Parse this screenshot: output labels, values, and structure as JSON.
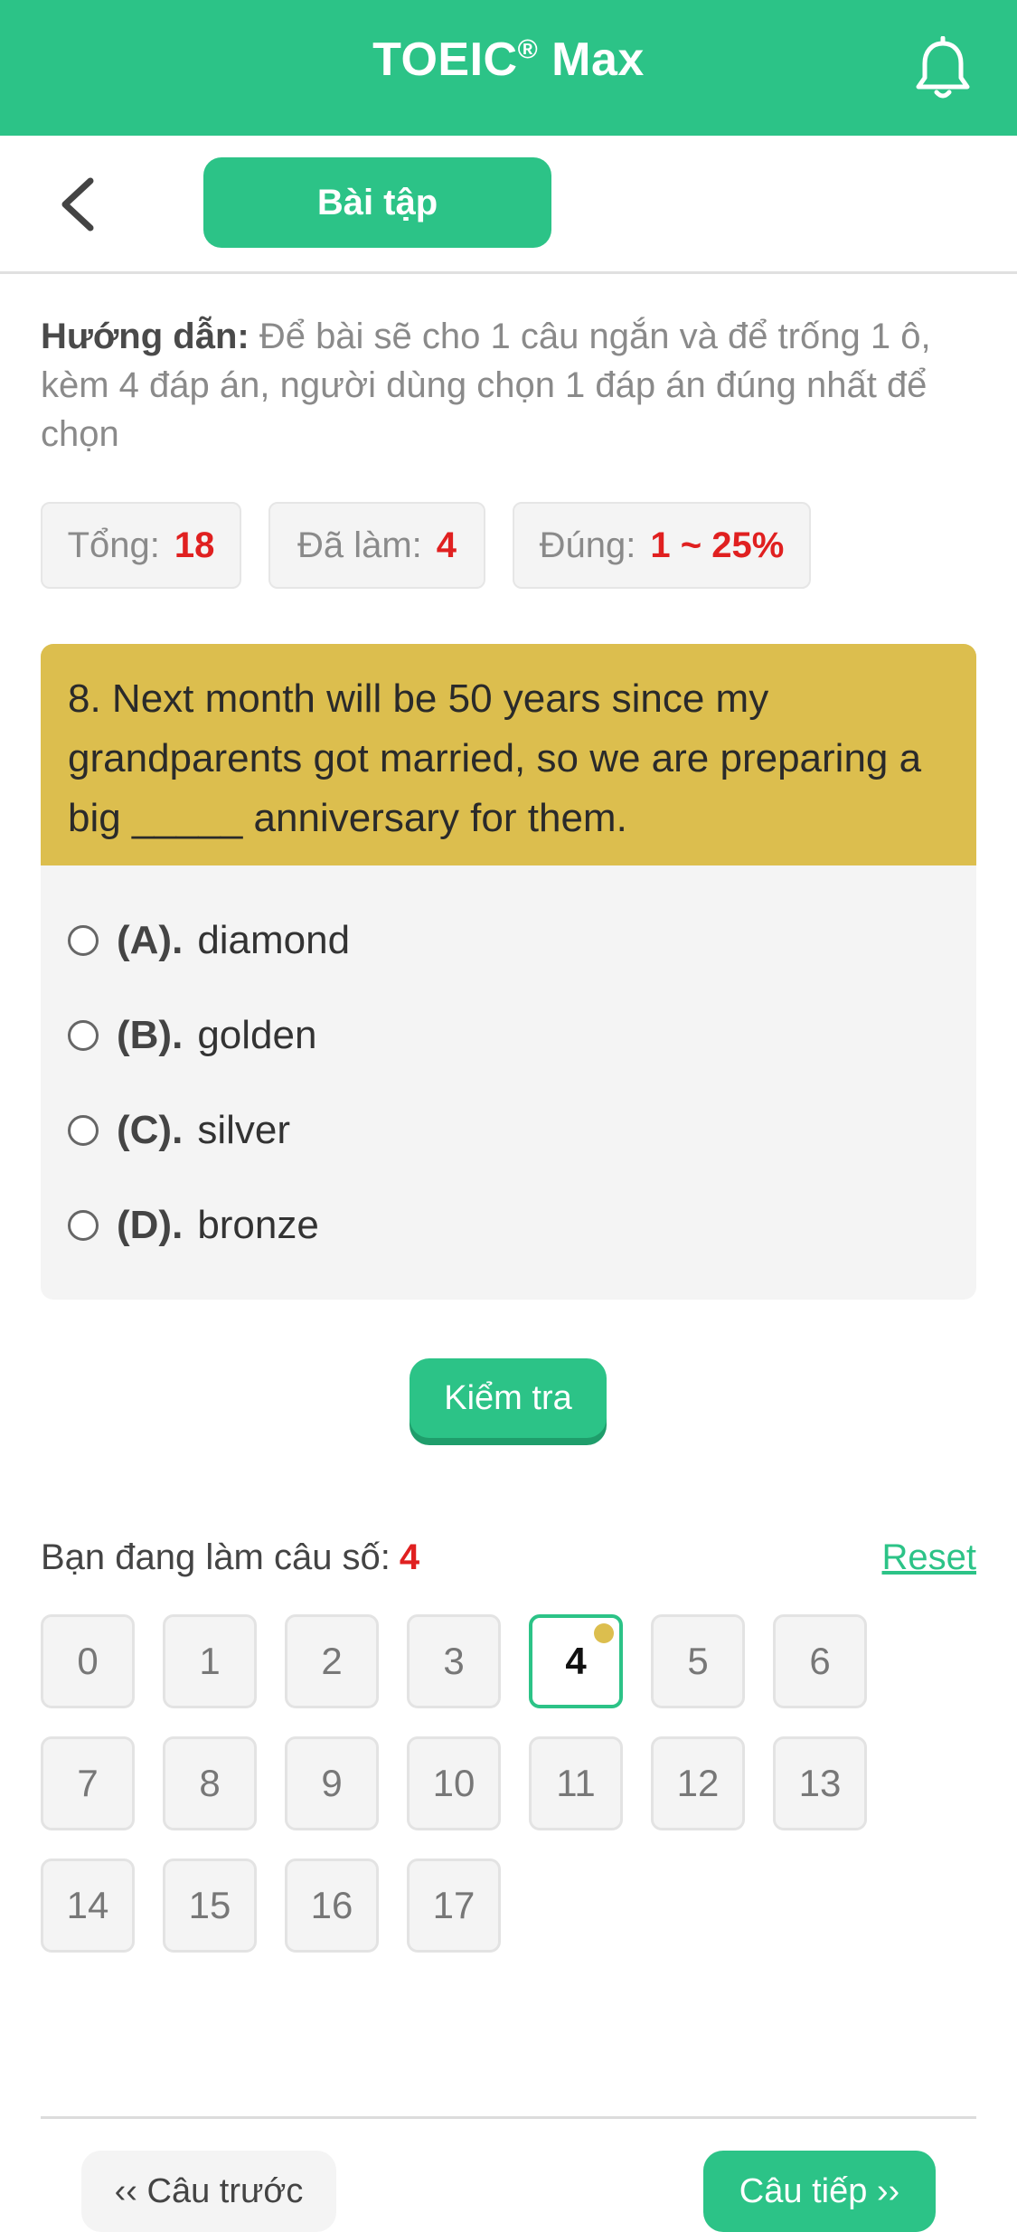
{
  "header": {
    "app_title": "TOEIC",
    "app_title_mark": "®",
    "app_title_suffix": " Max",
    "notification_icon": "bell-icon"
  },
  "nav": {
    "back_icon": "chevron-left-icon",
    "tab_label": "Bài tập"
  },
  "instructions": {
    "label": "Hướng dẫn:",
    "text": " Để bài sẽ cho 1 câu ngắn và để trống 1 ô, kèm 4 đáp án, người dùng chọn 1 đáp án đúng nhất để chọn"
  },
  "stats": {
    "total_label": "Tổng:",
    "total_value": "18",
    "done_label": "Đã làm:",
    "done_value": "4",
    "correct_label": "Đúng:",
    "correct_value": "1 ~ 25%"
  },
  "question": {
    "text": "8. Next month will be 50 years since my grandparents got married, so we are preparing a big _____ anniversary for them.",
    "options": [
      {
        "label": "(A).",
        "text": "diamond"
      },
      {
        "label": "(B).",
        "text": "golden"
      },
      {
        "label": "(C).",
        "text": "silver"
      },
      {
        "label": "(D).",
        "text": "bronze"
      }
    ]
  },
  "check_button": "Kiểm tra",
  "progress": {
    "current_label": "Bạn đang làm câu số:",
    "current_value": "4",
    "reset_label": "Reset",
    "numbers": [
      "0",
      "1",
      "2",
      "3",
      "4",
      "5",
      "6",
      "7",
      "8",
      "9",
      "10",
      "11",
      "12",
      "13",
      "14",
      "15",
      "16",
      "17"
    ],
    "active_index": 4
  },
  "footer": {
    "prev_label": "‹‹ Câu trước",
    "next_label": "Câu tiếp ››"
  }
}
